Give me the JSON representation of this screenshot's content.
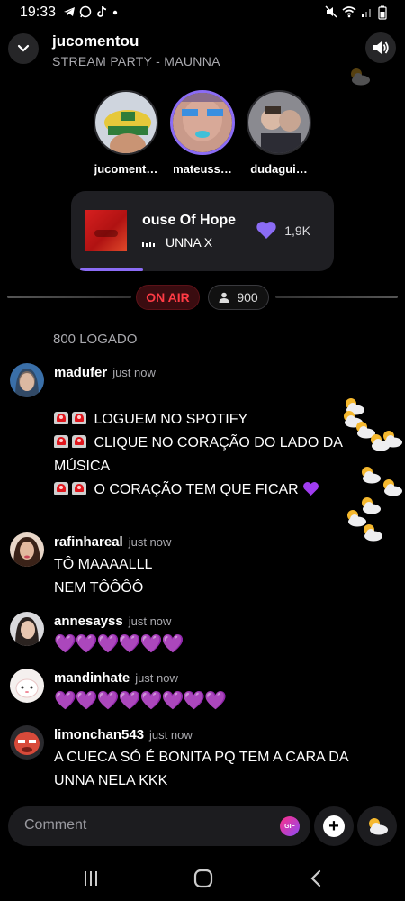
{
  "status_bar": {
    "time": "19:33",
    "left_icons": [
      "telegram-icon",
      "whatsapp-icon",
      "tiktok-icon",
      "dot-icon"
    ],
    "right_icons": [
      "mute-icon",
      "wifi-icon",
      "signal-icon",
      "battery-icon"
    ]
  },
  "header": {
    "title": "jucomentou",
    "subtitle": "STREAM PARTY - MAUNNA"
  },
  "participants": [
    {
      "name": "jucoment…",
      "active": false
    },
    {
      "name": "mateuss…",
      "active": true
    },
    {
      "name": "dudagui…",
      "active": false
    }
  ],
  "now_playing": {
    "song": "ouse Of Hope",
    "artist": "UNNA X",
    "likes": "1,9K",
    "progress": 0.24,
    "accent_color": "#8b6cf5"
  },
  "live": {
    "on_air_label": "ON AIR",
    "viewers": "900"
  },
  "logged_count": "800 LOGADO",
  "comments": [
    {
      "user": "madufer",
      "time": "just now",
      "lines": [
        "LOGUEM NO SPOTIFY",
        "CLIQUE NO CORAÇÃO DO LADO DA",
        "MÚSICA",
        "O CORAÇÃO TEM QUE FICAR"
      ]
    },
    {
      "user": "rafinhareal",
      "time": "just now",
      "lines": [
        "TÔ MAAAALLL",
        "NEM TÔÔÔÔ"
      ]
    },
    {
      "user": "annesayss",
      "time": "just now",
      "hearts": "💜💜💜💜💜💜"
    },
    {
      "user": "mandinhate",
      "time": "just now",
      "hearts": "💜💜💜💜💜💜💜💜"
    },
    {
      "user": "limonchan543",
      "time": "just now",
      "lines": [
        "A CUECA SÓ É BONITA PQ TEM A CARA DA",
        "UNNA NELA KKK"
      ]
    }
  ],
  "composer": {
    "placeholder": "Comment",
    "gif_label": "GIF"
  },
  "colors": {
    "on_air": "#ff3b45",
    "heart": "#a03cf0"
  }
}
